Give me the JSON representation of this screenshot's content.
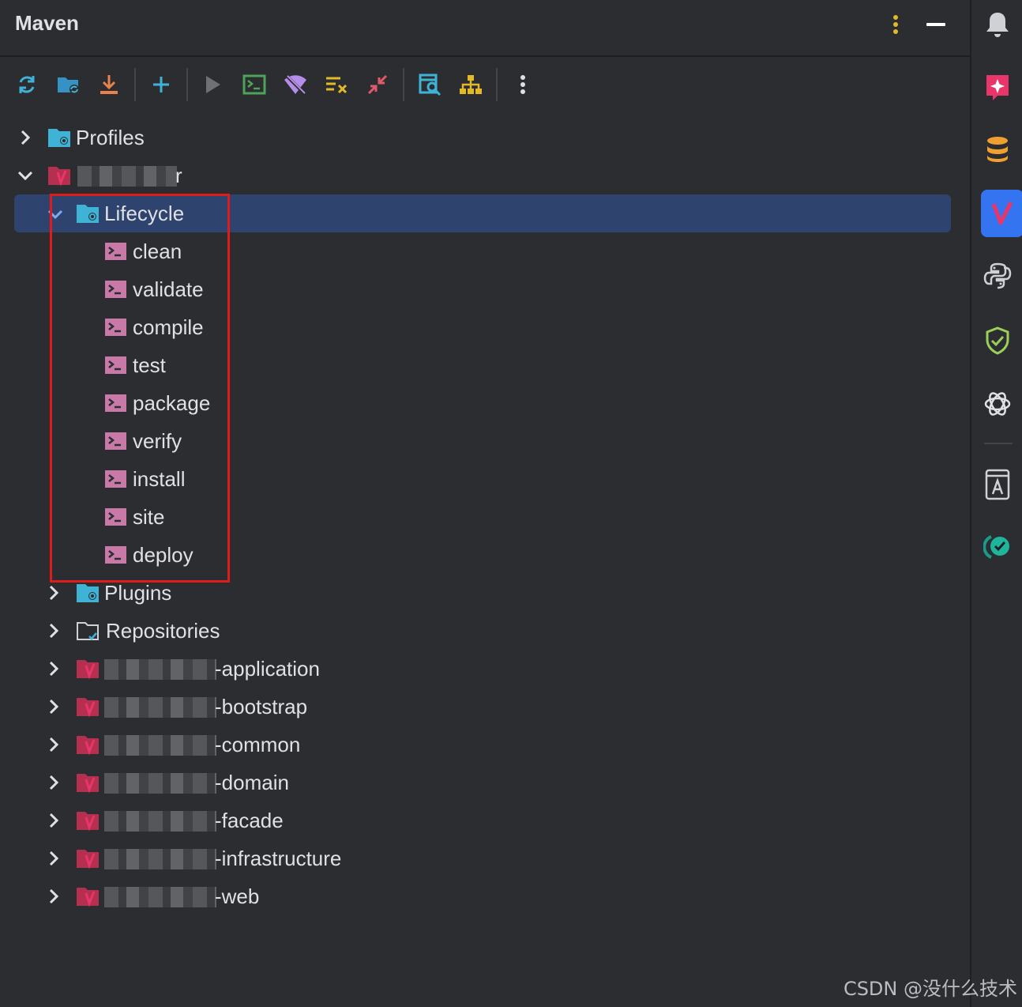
{
  "window": {
    "title": "Maven"
  },
  "toolbar": {
    "tools": [
      {
        "name": "reload-icon",
        "color": "#3fb3d6"
      },
      {
        "name": "generate-sources-icon",
        "color": "#3592c4"
      },
      {
        "name": "download-icon",
        "color": "#e8814a"
      },
      {
        "name": "add-icon",
        "color": "#3fb3d6"
      },
      {
        "name": "run-icon",
        "color": "#6e7075"
      },
      {
        "name": "execute-goal-icon",
        "color": "#4fa25a"
      },
      {
        "name": "offline-mode-icon",
        "color": "#b48ee8"
      },
      {
        "name": "skip-tests-icon",
        "color": "#e2b928"
      },
      {
        "name": "collapse-icon",
        "color": "#e05a6b"
      },
      {
        "name": "analyze-dependencies-icon",
        "color": "#3fb3d6"
      },
      {
        "name": "show-diagram-icon",
        "color": "#e2b928"
      }
    ]
  },
  "tree": {
    "profiles": "Profiles",
    "root_suffix": "r",
    "lifecycle": "Lifecycle",
    "goals": [
      "clean",
      "validate",
      "compile",
      "test",
      "package",
      "verify",
      "install",
      "site",
      "deploy"
    ],
    "plugins": "Plugins",
    "repositories": "Repositories",
    "modules": [
      "-application",
      "-bootstrap",
      "-common",
      "-domain",
      "-facade",
      "-infrastructure",
      "-web"
    ]
  },
  "sidebar": {
    "items": [
      "notifications-icon",
      "ai-assistant-icon",
      "database-icon",
      "maven-icon",
      "python-console-icon",
      "security-icon",
      "openai-icon",
      "dictionary-icon",
      "code-check-icon"
    ],
    "active": "maven-icon",
    "accent": "#3574f0"
  },
  "watermark": "CSDN @没什么技术"
}
